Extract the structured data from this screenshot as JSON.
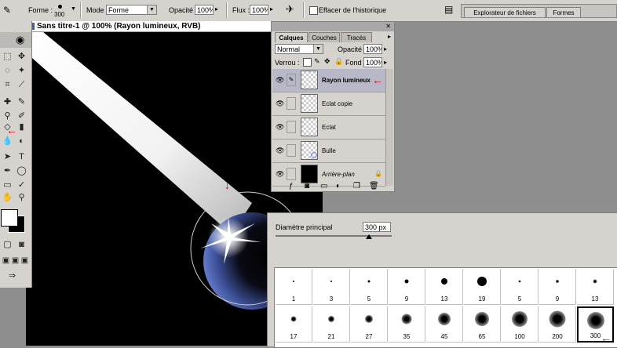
{
  "options_bar": {
    "shape_label": "Forme :",
    "shape_size": "300",
    "mode_label": "Mode :",
    "mode_value": "Forme",
    "opacity_label": "Opacité :",
    "opacity_value": "100%",
    "flow_label": "Flux :",
    "flow_value": "100%",
    "erase_history_label": "Effacer de l'historique"
  },
  "palette_well": {
    "tabs": [
      "Explorateur de fichiers",
      "Formes"
    ]
  },
  "document": {
    "title": "Sans titre-1 @ 100% (Rayon lumineux, RVB)"
  },
  "layers_palette": {
    "tabs": [
      "Calques",
      "Couches",
      "Tracés"
    ],
    "blend_mode": "Normal",
    "opacity_label": "Opacité :",
    "opacity_value": "100%",
    "lock_label": "Verrou :",
    "fill_label": "Fond :",
    "fill_value": "100%",
    "layers": [
      {
        "name": "Rayon lumineux",
        "selected": true
      },
      {
        "name": "Eclat copie",
        "selected": false
      },
      {
        "name": "Eclat",
        "selected": false
      },
      {
        "name": "Bulle",
        "selected": false
      },
      {
        "name": "Arrière-plan",
        "selected": false
      }
    ]
  },
  "brush_palette": {
    "diameter_label": "Diamètre principal",
    "diameter_value": "300 px",
    "brushes": [
      {
        "label": "1",
        "style": "hard",
        "size": 2
      },
      {
        "label": "3",
        "style": "hard",
        "size": 2
      },
      {
        "label": "5",
        "style": "hard",
        "size": 3
      },
      {
        "label": "9",
        "style": "hard",
        "size": 5
      },
      {
        "label": "13",
        "style": "hard",
        "size": 8
      },
      {
        "label": "19",
        "style": "hard",
        "size": 12
      },
      {
        "label": "5",
        "style": "soft",
        "size": 3
      },
      {
        "label": "9",
        "style": "soft",
        "size": 4
      },
      {
        "label": "13",
        "style": "soft",
        "size": 5
      },
      {
        "label": "17",
        "style": "soft",
        "size": 7
      },
      {
        "label": "21",
        "style": "soft",
        "size": 8
      },
      {
        "label": "27",
        "style": "soft",
        "size": 10
      },
      {
        "label": "35",
        "style": "soft",
        "size": 13
      },
      {
        "label": "45",
        "style": "soft",
        "size": 16
      },
      {
        "label": "65",
        "style": "soft",
        "size": 18
      },
      {
        "label": "100",
        "style": "soft",
        "size": 20
      },
      {
        "label": "200",
        "style": "soft",
        "size": 21
      },
      {
        "label": "300",
        "style": "soft",
        "size": 22,
        "selected": true
      }
    ]
  },
  "colors": {
    "ui_gray": "#d6d3ce",
    "accent_arrow": "#e00000",
    "bubble_blue": "#6f86d6"
  }
}
